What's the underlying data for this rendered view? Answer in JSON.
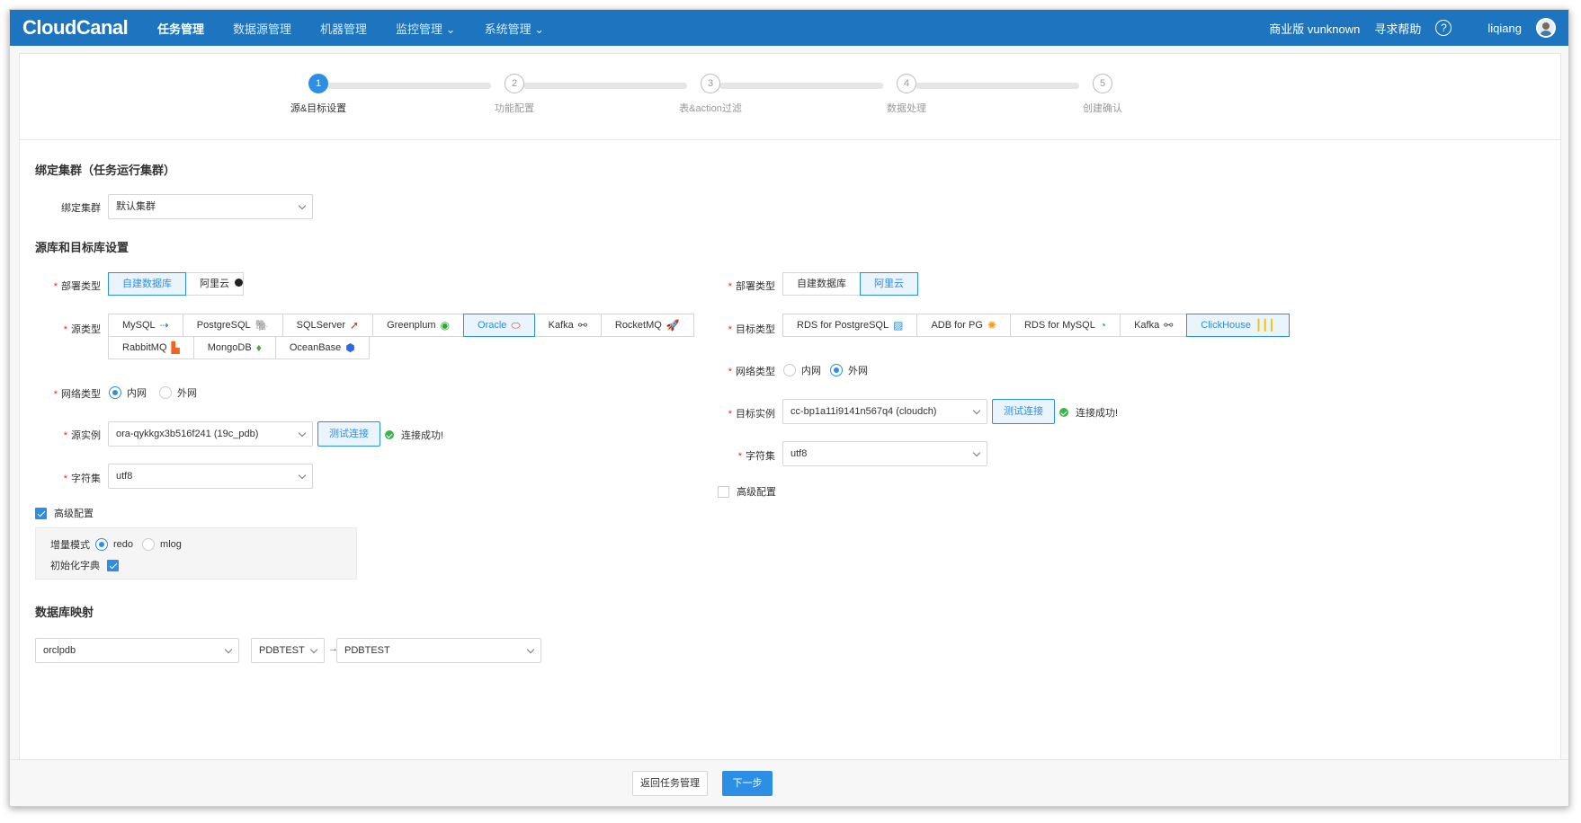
{
  "nav": {
    "logo": "CloudCanal",
    "items": [
      {
        "label": "任务管理",
        "active": true
      },
      {
        "label": "数据源管理",
        "active": false
      },
      {
        "label": "机器管理",
        "active": false
      },
      {
        "label": "监控管理 ⌄",
        "active": false
      },
      {
        "label": "系统管理 ⌄",
        "active": false
      }
    ],
    "edition": "商业版 vunknown",
    "help": "寻求帮助",
    "help_icon": "?",
    "user": "liqiang"
  },
  "steps": [
    {
      "num": "1",
      "label": "源&目标设置"
    },
    {
      "num": "2",
      "label": "功能配置"
    },
    {
      "num": "3",
      "label": "表&action过滤"
    },
    {
      "num": "4",
      "label": "数据处理"
    },
    {
      "num": "5",
      "label": "创建确认"
    }
  ],
  "cluster": {
    "section_title": "绑定集群（任务运行集群）",
    "label": "绑定集群",
    "value": "默认集群"
  },
  "db_section_title": "源库和目标库设置",
  "source": {
    "deploy_label": "部署类型",
    "deploy_options": [
      "自建数据库",
      "阿里云"
    ],
    "type_label": "源类型",
    "types_row1": [
      "MySQL",
      "PostgreSQL",
      "SQLServer",
      "Greenplum",
      "Oracle",
      "Kafka",
      "RocketMQ"
    ],
    "types_row2": [
      "RabbitMQ",
      "MongoDB",
      "OceanBase"
    ],
    "network_label": "网络类型",
    "network_options": [
      "内网",
      "外网"
    ],
    "instance_label": "源实例",
    "instance_value": "ora-qykkgx3b516f241 (19c_pdb)",
    "test_button": "测试连接",
    "status": "连接成功!",
    "charset_label": "字符集",
    "charset_value": "utf8",
    "advanced_label": "高级配置",
    "incr_label": "增量模式",
    "incr_options": [
      "redo",
      "mlog"
    ],
    "init_dict_label": "初始化字典"
  },
  "target": {
    "deploy_label": "部署类型",
    "deploy_options": [
      "自建数据库",
      "阿里云"
    ],
    "type_label": "目标类型",
    "types": [
      "RDS for PostgreSQL",
      "ADB for PG",
      "RDS for MySQL",
      "Kafka",
      "ClickHouse"
    ],
    "network_label": "网络类型",
    "network_options": [
      "内网",
      "外网"
    ],
    "instance_label": "目标实例",
    "instance_value": "cc-bp1a11i9141n567q4 (cloudch)",
    "test_button": "测试连接",
    "status": "连接成功!",
    "charset_label": "字符集",
    "charset_value": "utf8",
    "advanced_label": "高级配置"
  },
  "mapping": {
    "section_title": "数据库映射",
    "source_db": "orclpdb",
    "source_schema": "PDBTEST",
    "target_db": "PDBTEST"
  },
  "footer": {
    "back_button": "返回任务管理",
    "next_button": "下一步"
  },
  "colors": {
    "nav": "#1d75c0",
    "primary": "#2d8ee6",
    "success": "#39b54a"
  }
}
